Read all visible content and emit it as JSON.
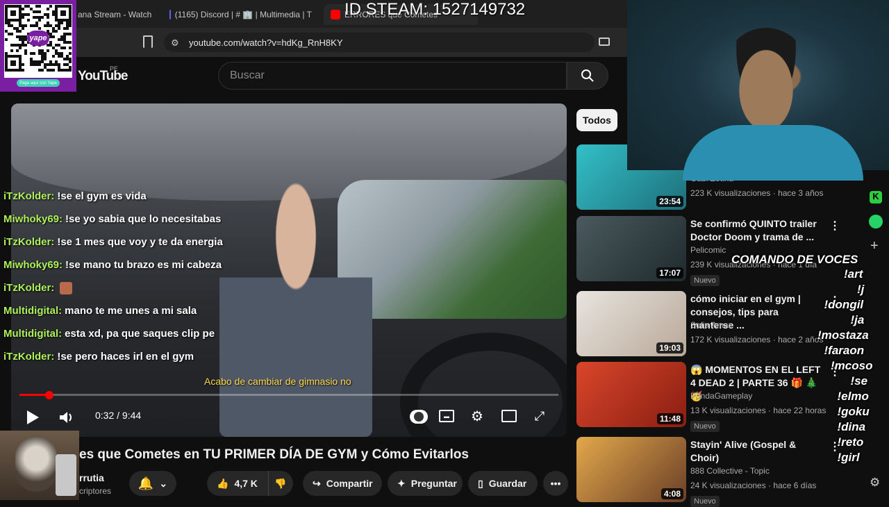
{
  "browser": {
    "tabs": [
      {
        "label": "ana Stream - Watch L",
        "favicon_color": "#6441a5"
      },
      {
        "label": "(1165) Discord | # 🏢 | Multimedia | T",
        "favicon_color": "#5865f2"
      },
      {
        "label": "ERRORES que Cometes",
        "favicon_color": "#ff0000"
      }
    ],
    "url": "youtube.com/watch?v=hdKg_RnH8KY"
  },
  "youtube": {
    "logo": "YouTube",
    "region": "PE",
    "search_placeholder": "Buscar"
  },
  "video": {
    "time": "0:32 / 9:44",
    "progress_fraction": 0.055,
    "subtitle": "Acabo de cambiar de gimnasio no",
    "title": "es que Cometes en TU PRIMER DÍA DE GYM y Cómo Evitarlos",
    "channel": "rrutia",
    "subs": "criptores",
    "likes": "4,7 K",
    "share": "Compartir",
    "ask": "Preguntar",
    "save": "Guardar"
  },
  "chat": [
    {
      "user": "iTzKolder:",
      "msg": "!se el gym es vida",
      "dim": true
    },
    {
      "user": "Miwhoky69:",
      "msg": "!se yo sabia que lo necesitabas",
      "dim": false
    },
    {
      "user": "iTzKolder:",
      "msg": "!se 1 mes que voy y te da energia",
      "dim": false
    },
    {
      "user": "Miwhoky69:",
      "msg": "!se mano tu brazo es mi cabeza",
      "dim": false
    },
    {
      "user": "iTzKolder:",
      "msg": "",
      "dim": false
    },
    {
      "user": "Multidigital:",
      "msg": "mano te me unes a mi sala",
      "dim": false
    },
    {
      "user": "Multidigital:",
      "msg": "esta xd, pa que saques clip pe",
      "dim": false
    },
    {
      "user": "iTzKolder:",
      "msg": "!se pero haces irl en el gym",
      "dim": true
    }
  ],
  "sidebar": {
    "chip": "Todos",
    "videos": [
      {
        "title": "",
        "channel": "Gabi Zetina",
        "meta": "223 K visualizaciones · hace 3 años",
        "duration": "23:54",
        "badge": "",
        "thumb_colors": [
          "#33c0c8",
          "#1e6f7a"
        ]
      },
      {
        "title": "Se confirmó QUINTO trailer Doctor Doom y trama de ...",
        "channel": "Pelicomic",
        "meta": "239 K visualizaciones · hace 1 día",
        "duration": "17:07",
        "badge": "Nuevo",
        "thumb_colors": [
          "#4a5a5e",
          "#1f2a2c"
        ]
      },
      {
        "title": "cómo iniciar en el gym | consejos, tips para manterse ...",
        "channel": "Sofia Amar",
        "meta": "172 K visualizaciones · hace 2 años",
        "duration": "19:03",
        "badge": "",
        "thumb_colors": [
          "#e8e4df",
          "#b8a898"
        ]
      },
      {
        "title": "😱 MOMENTOS EN EL LEFT 4 DEAD 2 | PARTE 36 🎁 🎄 🥳",
        "channel": "PandaGameplay",
        "meta": "13 K visualizaciones · hace 22 horas",
        "duration": "11:48",
        "badge": "Nuevo",
        "thumb_colors": [
          "#d9462a",
          "#8a1e12"
        ]
      },
      {
        "title": "Stayin' Alive (Gospel & Choir)",
        "channel": "888 Collective - Topic",
        "meta": "24 K visualizaciones · hace 6 días",
        "duration": "4:08",
        "badge": "Nuevo",
        "thumb_colors": [
          "#e3a84a",
          "#6a3f28"
        ]
      }
    ]
  },
  "overlay": {
    "steam_id": "ID STEAM: 1527149732",
    "qr_caption": "Paga aquí con Yape",
    "qr_brand": "yape",
    "commands_title": "COMANDO DE VOCES",
    "commands": [
      "!art",
      "!j",
      "!dongil",
      "!ja",
      "!mostaza",
      "!faraon",
      "!mcoso",
      "!se",
      "!elmo",
      "!goku",
      "!dina",
      "!reto",
      "!girl"
    ]
  }
}
